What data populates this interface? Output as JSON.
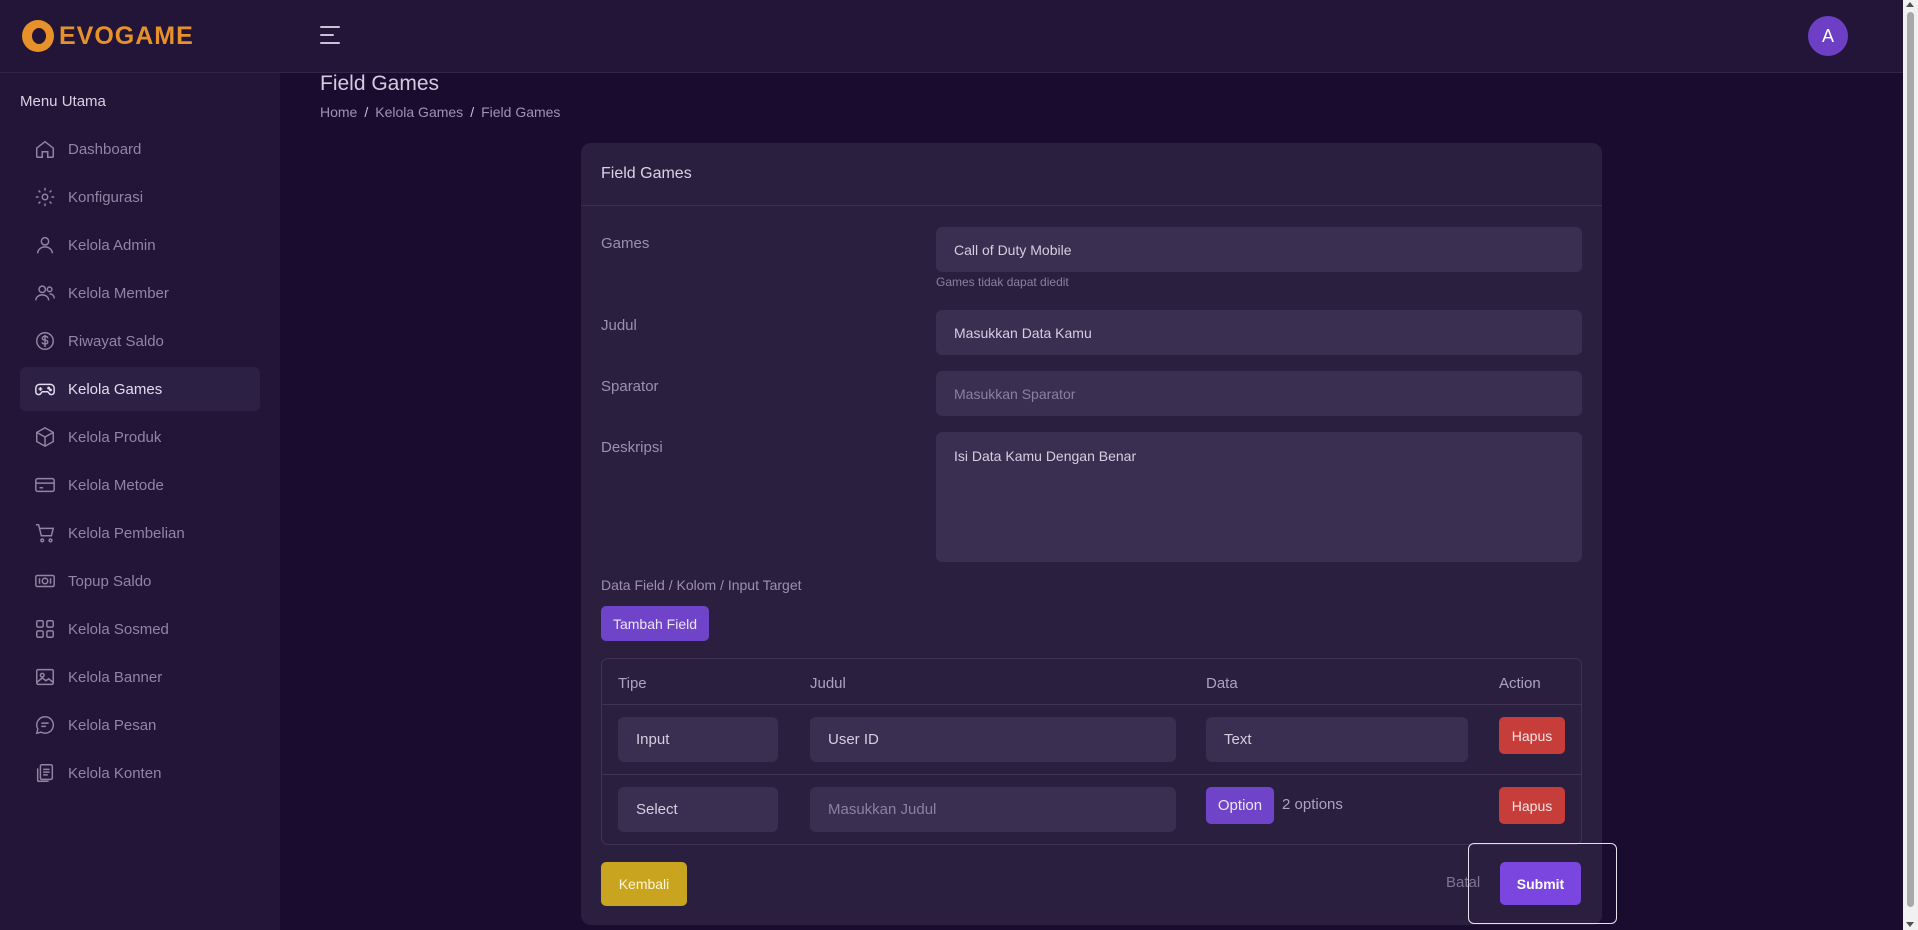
{
  "brand": {
    "name": "EVOGAME",
    "logo_icon": "evogame-logo-icon"
  },
  "user": {
    "avatar_letter": "A"
  },
  "sidebar": {
    "title": "Menu Utama",
    "items": [
      {
        "label": "Dashboard",
        "icon": "home-icon"
      },
      {
        "label": "Konfigurasi",
        "icon": "gear-icon"
      },
      {
        "label": "Kelola Admin",
        "icon": "user-icon"
      },
      {
        "label": "Kelola Member",
        "icon": "users-icon"
      },
      {
        "label": "Riwayat Saldo",
        "icon": "dollar-icon"
      },
      {
        "label": "Kelola Games",
        "icon": "gamepad-icon",
        "active": true
      },
      {
        "label": "Kelola Produk",
        "icon": "box-icon"
      },
      {
        "label": "Kelola Metode",
        "icon": "credit-card-icon"
      },
      {
        "label": "Kelola Pembelian",
        "icon": "cart-icon"
      },
      {
        "label": "Topup Saldo",
        "icon": "money-icon"
      },
      {
        "label": "Kelola Sosmed",
        "icon": "grid-icon"
      },
      {
        "label": "Kelola Banner",
        "icon": "image-icon"
      },
      {
        "label": "Kelola Pesan",
        "icon": "chat-icon"
      },
      {
        "label": "Kelola Konten",
        "icon": "documents-icon"
      }
    ]
  },
  "page": {
    "title": "Field Games",
    "breadcrumb": [
      "Home",
      "Kelola Games",
      "Field Games"
    ],
    "breadcrumb_sep": "/"
  },
  "form": {
    "card_title": "Field Games",
    "games_label": "Games",
    "games_value": "Call of Duty Mobile",
    "games_hint": "Games tidak dapat diedit",
    "judul_label": "Judul",
    "judul_value": "Masukkan Data Kamu",
    "sparator_label": "Sparator",
    "sparator_placeholder": "Masukkan Sparator",
    "deskripsi_label": "Deskripsi",
    "deskripsi_value": "Isi Data Kamu Dengan Benar",
    "fields_label": "Data Field / Kolom / Input Target",
    "add_field_label": "Tambah Field"
  },
  "table": {
    "headers": [
      "Tipe",
      "Judul",
      "Data",
      "Action"
    ],
    "rows": [
      {
        "tipe": "Input",
        "judul": "User ID",
        "judul_placeholder": false,
        "data": "Text",
        "action": "Hapus"
      },
      {
        "tipe": "Select",
        "judul": "Masukkan Judul",
        "judul_placeholder": true,
        "option_label": "Option",
        "option_count": "2 options",
        "action": "Hapus"
      }
    ]
  },
  "actions": {
    "back": "Kembali",
    "cancel": "Batal",
    "submit": "Submit"
  },
  "colors": {
    "background": "#1a0c2e",
    "panel": "#221537",
    "card": "#2b1f40",
    "accent": "#6f44c9",
    "danger": "#c63d3a",
    "warning": "#c8a41f",
    "brand": "#e7912b"
  }
}
